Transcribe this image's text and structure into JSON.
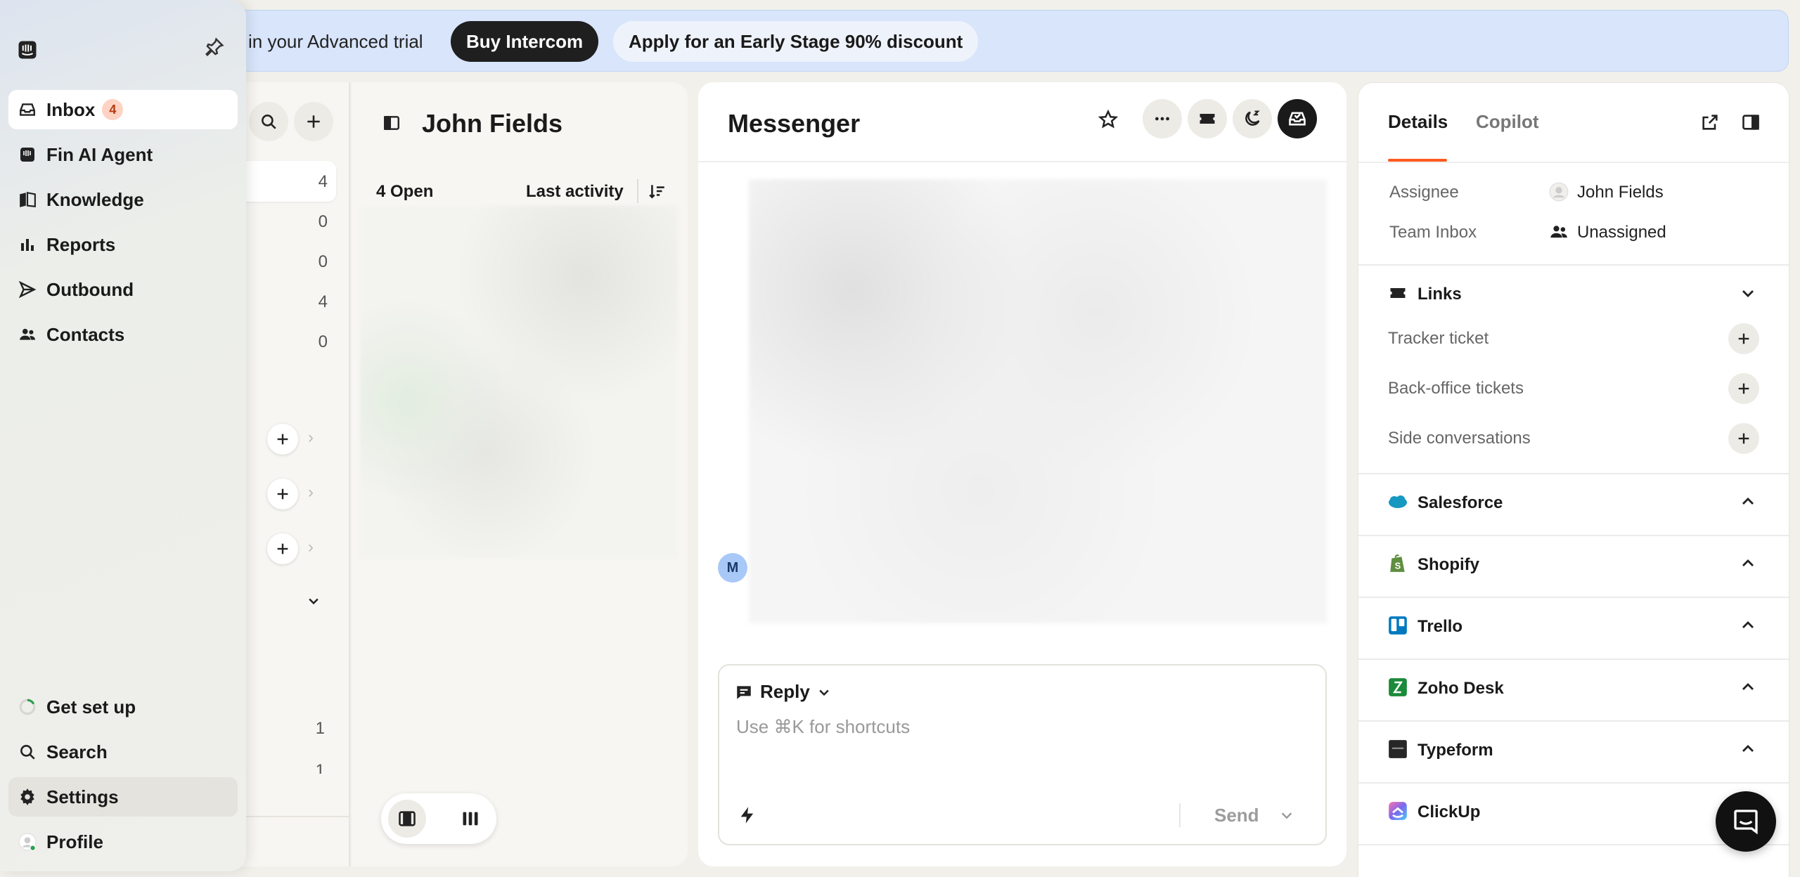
{
  "banner": {
    "trial_text": "in your Advanced trial",
    "buy_button": "Buy Intercom",
    "discount_button": "Apply for an Early Stage 90% discount"
  },
  "sidebar": {
    "items": [
      {
        "label": "Inbox",
        "icon": "inbox-icon",
        "badge": "4"
      },
      {
        "label": "Fin AI Agent",
        "icon": "fin-icon"
      },
      {
        "label": "Knowledge",
        "icon": "book-icon"
      },
      {
        "label": "Reports",
        "icon": "bar-chart-icon"
      },
      {
        "label": "Outbound",
        "icon": "send-icon"
      },
      {
        "label": "Contacts",
        "icon": "people-icon"
      }
    ],
    "bottom": [
      {
        "label": "Get set up",
        "icon": "progress-ring-icon"
      },
      {
        "label": "Search",
        "icon": "search-icon"
      },
      {
        "label": "Settings",
        "icon": "gear-icon"
      },
      {
        "label": "Profile",
        "icon": "avatar"
      }
    ]
  },
  "inbox_list": {
    "counts": [
      "4",
      "0",
      "0",
      "4",
      "0"
    ],
    "extra_counts": [
      "1",
      "1"
    ]
  },
  "conversation_list": {
    "title": "John Fields",
    "open_count": "4 Open",
    "sort_label": "Last activity"
  },
  "messenger": {
    "title": "Messenger",
    "avatar_initial": "M",
    "reply_mode": "Reply",
    "reply_placeholder": "Use ⌘K for shortcuts",
    "send_label": "Send"
  },
  "details": {
    "tabs": [
      "Details",
      "Copilot"
    ],
    "assignee_label": "Assignee",
    "assignee_value": "John Fields",
    "team_label": "Team Inbox",
    "team_value": "Unassigned",
    "links_title": "Links",
    "links": [
      "Tracker ticket",
      "Back-office tickets",
      "Side conversations"
    ],
    "integrations": [
      "Salesforce",
      "Shopify",
      "Trello",
      "Zoho Desk",
      "Typeform",
      "ClickUp"
    ],
    "colors": {
      "accent": "#ff5a1f",
      "salesforce": "#1798c1",
      "shopify": "#5e8e3e",
      "trello": "#0079bf",
      "zoho": "#1b8a3a",
      "typeform": "#262627",
      "clickup": "#7b68ee"
    }
  }
}
